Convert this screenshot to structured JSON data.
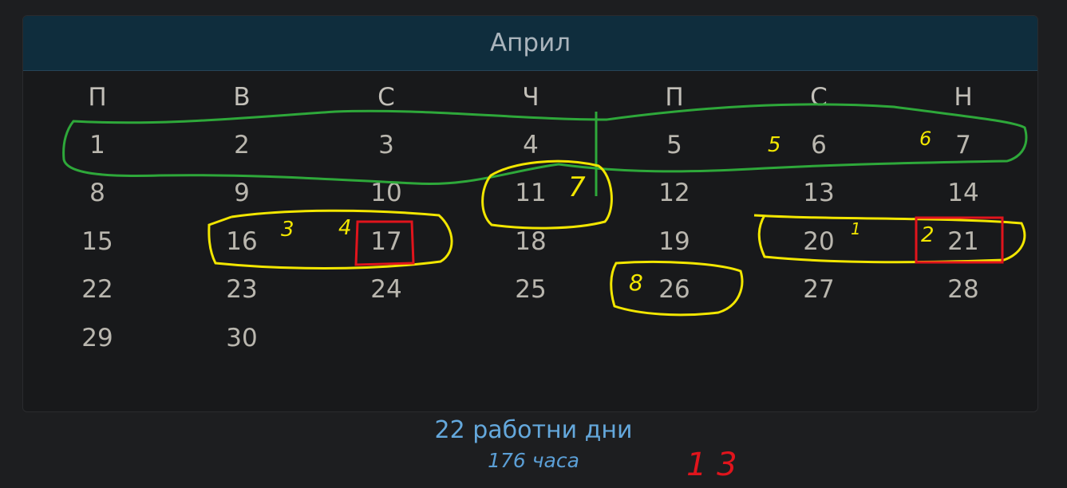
{
  "calendar": {
    "month": "Април",
    "weekdays": [
      "П",
      "В",
      "С",
      "Ч",
      "П",
      "С",
      "Н"
    ],
    "days": [
      "1",
      "2",
      "3",
      "4",
      "5",
      "6",
      "7",
      "8",
      "9",
      "10",
      "11",
      "12",
      "13",
      "14",
      "15",
      "16",
      "17",
      "18",
      "19",
      "20",
      "21",
      "22",
      "23",
      "24",
      "25",
      "26",
      "27",
      "28",
      "29",
      "30"
    ],
    "first_day_offset": 0
  },
  "summary": {
    "workdays": "22 работни дни",
    "hours": "176 часа"
  },
  "annotations": {
    "colors": {
      "green": "#2ea83a",
      "yellow": "#f2e600",
      "red": "#e0141c"
    },
    "marks": [
      "1",
      "2",
      "3",
      "4",
      "5",
      "6",
      "7",
      "8"
    ],
    "note": "1 3"
  }
}
